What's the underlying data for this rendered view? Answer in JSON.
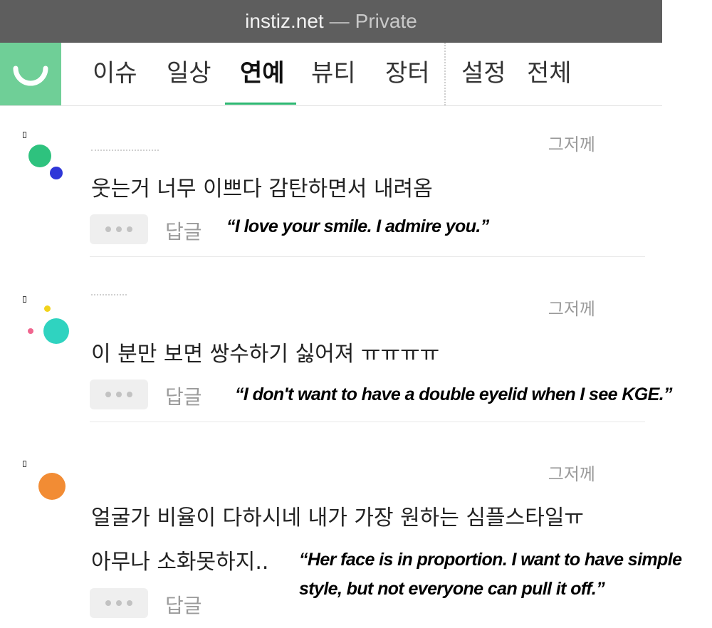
{
  "window": {
    "domain": "instiz.net",
    "separator": "—",
    "mode": "Private"
  },
  "nav": {
    "tabs": [
      "이슈",
      "일상",
      "연예",
      "뷰티",
      "장터",
      "설정",
      "전체"
    ],
    "active": "연예"
  },
  "colors": {
    "logo_bg": "#6fcf97",
    "active_underline": "#2eb872"
  },
  "comments": [
    {
      "timestamp": "그저께",
      "text": "웃는거 너무 이쁘다 감탄하면서 내려옴",
      "reply_label": "답글",
      "caption": "“I love your smile. I admire you.”",
      "avatar_color": "#2ec27e",
      "accent_color": "#2f37d8"
    },
    {
      "timestamp": "그저께",
      "text": "이 분만 보면 쌍수하기 싫어져 ㅠㅠㅠㅠ",
      "reply_label": "답글",
      "caption": "“I don't want to have a double eyelid when I see KGE.”",
      "avatar_color": "#2fd3c0",
      "accent_color": "#f2d31b",
      "accent2_color": "#f0668f"
    },
    {
      "timestamp": "그저께",
      "text_line1": "얼굴가 비율이 다하시네 내가 가장 원하는 심플스타일ㅠ",
      "text_line2": "아무나 소화못하지..",
      "reply_label": "답글",
      "caption_line1": "“Her face is in proportion. I want to have simple",
      "caption_line2": "style, but not everyone can pull it off.”",
      "avatar_color": "#f28c34"
    }
  ]
}
